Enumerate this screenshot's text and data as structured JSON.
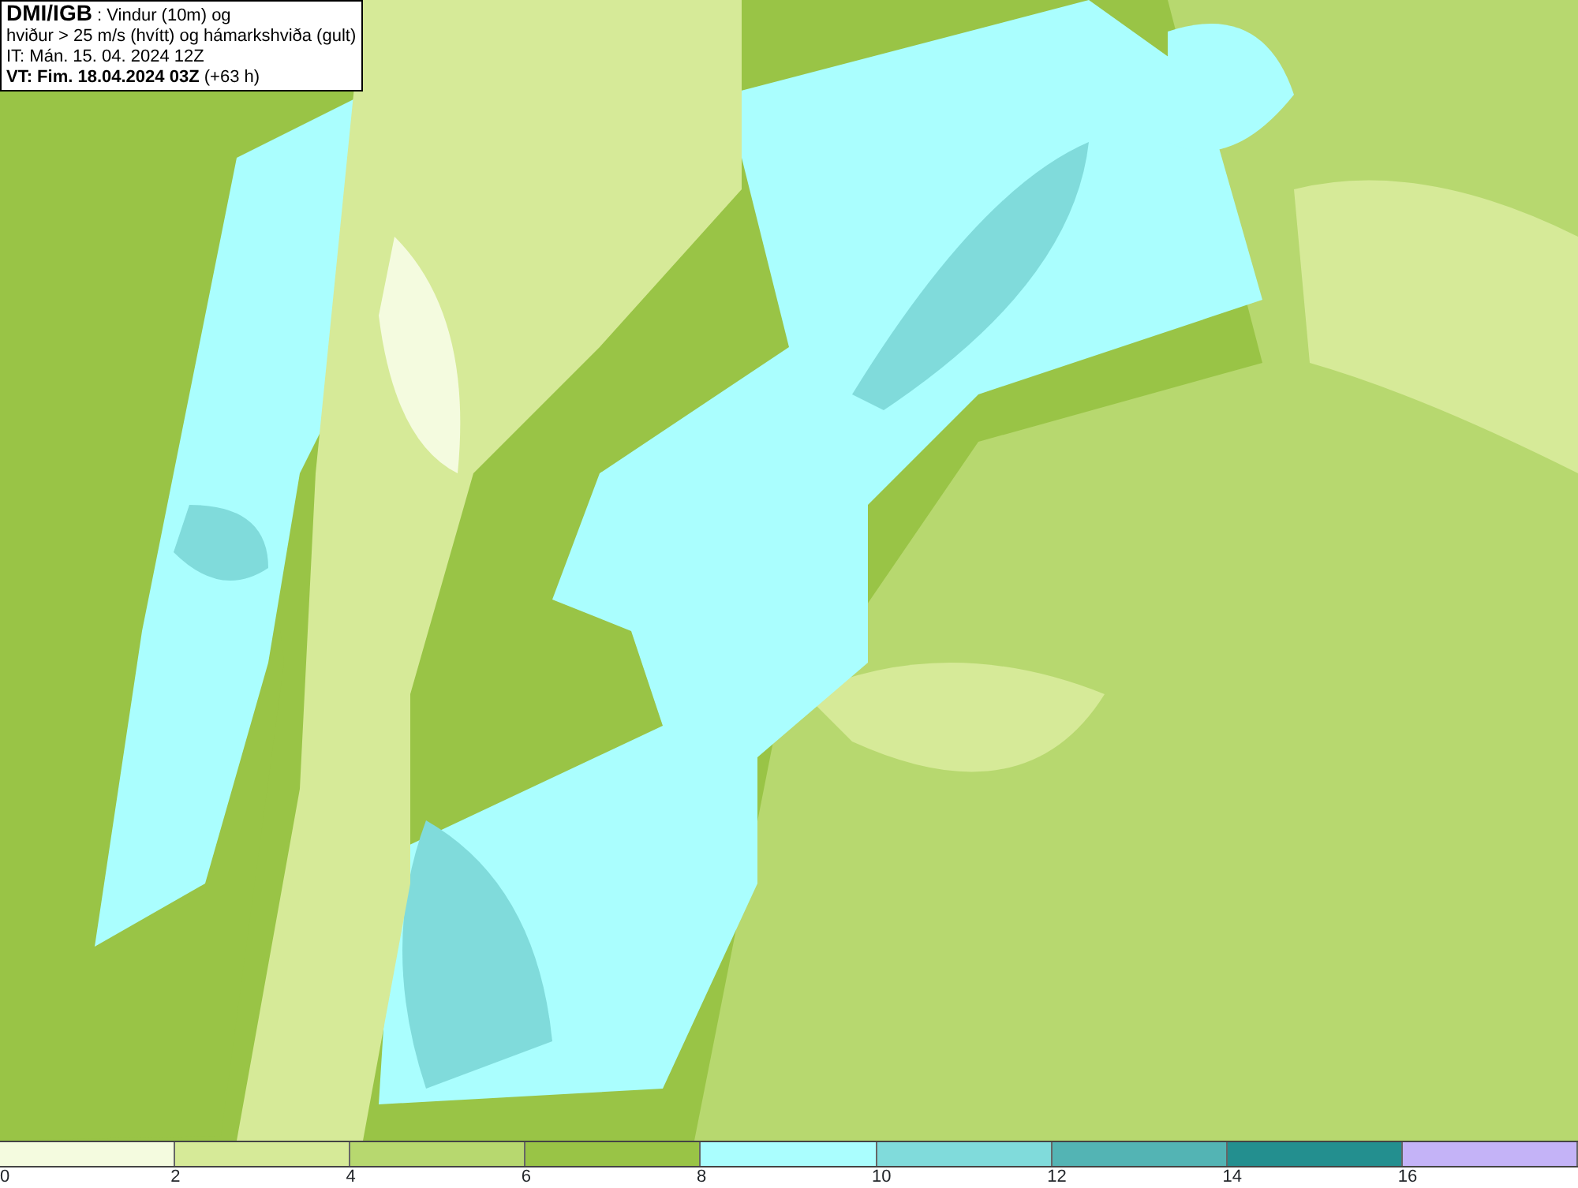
{
  "title_box": {
    "source": "DMI/IGB",
    "description": ": Vindur (10m) og",
    "line_2": "hviður > 25 m/s (hvítt) og hámarkshviða (gult)",
    "issue_time": "IT: Mán. 15. 04. 2024 12Z",
    "valid_time": "VT: Fim. 18.04.2024 03Z",
    "lead_time": "(+63 h)"
  },
  "legend": {
    "bins": [
      {
        "color": "#f4fbdf"
      },
      {
        "color": "#d6ea98"
      },
      {
        "color": "#b7d86f"
      },
      {
        "color": "#99c446"
      },
      {
        "color": "#aafefe"
      },
      {
        "color": "#80dbdb"
      },
      {
        "color": "#53b4b4"
      },
      {
        "color": "#238f8f"
      },
      {
        "color": "#c4b3f7"
      }
    ],
    "ticks": [
      "0",
      "2",
      "4",
      "6",
      "8",
      "10",
      "12",
      "14",
      "16"
    ]
  }
}
